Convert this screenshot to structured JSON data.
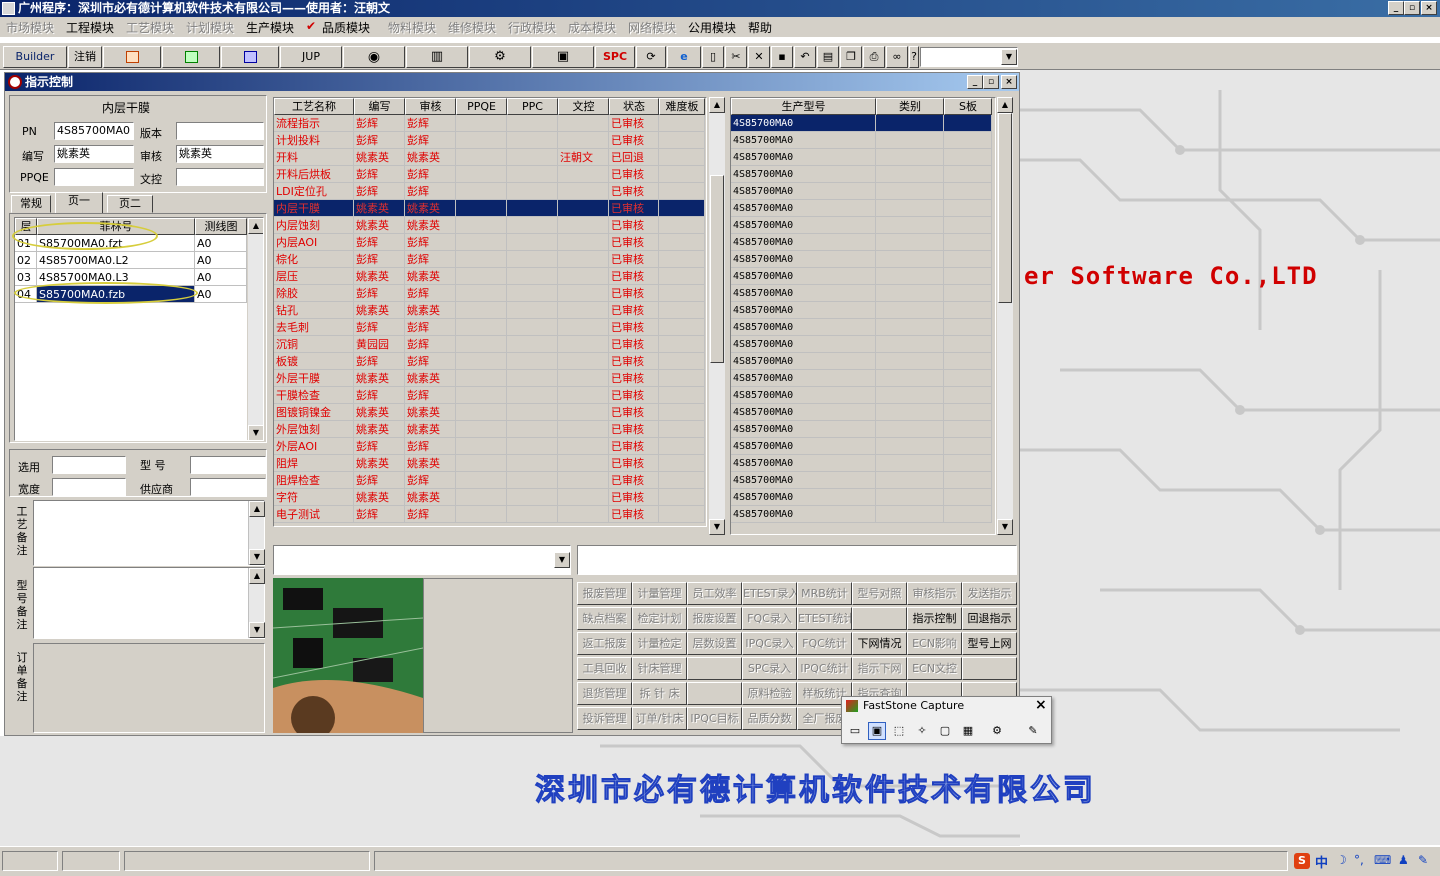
{
  "app": {
    "title": "广州程序：深圳市必有德计算机软件技术有限公司——使用者：汪朝文",
    "win_buttons": [
      "_",
      "▫",
      "×"
    ]
  },
  "menu": [
    {
      "label": "市场模块",
      "enabled": false
    },
    {
      "label": "工程模块",
      "enabled": true
    },
    {
      "label": "工艺模块",
      "enabled": false
    },
    {
      "label": "计划模块",
      "enabled": false
    },
    {
      "label": "生产模块",
      "enabled": true
    },
    {
      "label": "品质模块",
      "enabled": true
    },
    {
      "label": "物料模块",
      "enabled": false
    },
    {
      "label": "维修模块",
      "enabled": false
    },
    {
      "label": "行政模块",
      "enabled": false
    },
    {
      "label": "成本模块",
      "enabled": false
    },
    {
      "label": "网络模块",
      "enabled": false
    },
    {
      "label": "公用模块",
      "enabled": true
    },
    {
      "label": "帮助",
      "enabled": true
    }
  ],
  "toolbar": {
    "builder": "Builder",
    "logout": "注销",
    "jup": "JUP",
    "spc": "SPC"
  },
  "watermark": "er Software Co.,LTD",
  "banner": "深圳市必有德计算机软件技术有限公司",
  "child": {
    "title": "指示控制",
    "section_title": "内层干膜",
    "pn_label": "PN",
    "pn_value": "4S85700MA0",
    "version_label": "版本",
    "version_value": "",
    "author_label": "编写",
    "author_value": "姚素英",
    "review_label": "审核",
    "review_value": "姚素英",
    "ppqe_label": "PPQE",
    "ppqe_value": "",
    "doc_label": "文控",
    "doc_value": "",
    "tabs": [
      "常规",
      "页一",
      "页二"
    ],
    "film_headers": [
      "层",
      "菲林号",
      "测线图"
    ],
    "film_rows": [
      {
        "layer": "01",
        "film": "S85700MA0.fzt",
        "chart": "A0"
      },
      {
        "layer": "02",
        "film": "4S85700MA0.L2",
        "chart": "A0"
      },
      {
        "layer": "03",
        "film": "4S85700MA0.L3",
        "chart": "A0"
      },
      {
        "layer": "04",
        "film": "S85700MA0.fzb",
        "chart": "A0"
      }
    ],
    "choose_label": "选用",
    "model_label": "型  号",
    "width_label": "宽度",
    "supplier_label": "供应商",
    "note_process": "工艺备注",
    "note_model": "型号备注",
    "note_order": "订单备注"
  },
  "process_table": {
    "headers": [
      "工艺名称",
      "编写",
      "审核",
      "PPQE",
      "PPC",
      "文控",
      "状态",
      "难度板"
    ],
    "rows": [
      [
        "流程指示",
        "彭辉",
        "彭辉",
        "",
        "",
        "",
        "已审核"
      ],
      [
        "计划投料",
        "彭辉",
        "彭辉",
        "",
        "",
        "",
        "已审核"
      ],
      [
        "开料",
        "姚素英",
        "姚素英",
        "",
        "",
        "汪朝文",
        "已回退"
      ],
      [
        "开料后烘板",
        "彭辉",
        "彭辉",
        "",
        "",
        "",
        "已审核"
      ],
      [
        "LDI定位孔",
        "彭辉",
        "彭辉",
        "",
        "",
        "",
        "已审核"
      ],
      [
        "内层干膜",
        "姚素英",
        "姚素英",
        "",
        "",
        "",
        "已审核"
      ],
      [
        "内层蚀刻",
        "姚素英",
        "姚素英",
        "",
        "",
        "",
        "已审核"
      ],
      [
        "内层AOI",
        "彭辉",
        "彭辉",
        "",
        "",
        "",
        "已审核"
      ],
      [
        "棕化",
        "彭辉",
        "彭辉",
        "",
        "",
        "",
        "已审核"
      ],
      [
        "层压",
        "姚素英",
        "姚素英",
        "",
        "",
        "",
        "已审核"
      ],
      [
        "除胶",
        "彭辉",
        "彭辉",
        "",
        "",
        "",
        "已审核"
      ],
      [
        "钻孔",
        "姚素英",
        "姚素英",
        "",
        "",
        "",
        "已审核"
      ],
      [
        "去毛刺",
        "彭辉",
        "彭辉",
        "",
        "",
        "",
        "已审核"
      ],
      [
        "沉铜",
        "黄园园",
        "彭辉",
        "",
        "",
        "",
        "已审核"
      ],
      [
        "板镀",
        "彭辉",
        "彭辉",
        "",
        "",
        "",
        "已审核"
      ],
      [
        "外层干膜",
        "姚素英",
        "姚素英",
        "",
        "",
        "",
        "已审核"
      ],
      [
        "干膜检查",
        "彭辉",
        "彭辉",
        "",
        "",
        "",
        "已审核"
      ],
      [
        "图镀铜镍金",
        "姚素英",
        "姚素英",
        "",
        "",
        "",
        "已审核"
      ],
      [
        "外层蚀刻",
        "姚素英",
        "姚素英",
        "",
        "",
        "",
        "已审核"
      ],
      [
        "外层AOI",
        "彭辉",
        "彭辉",
        "",
        "",
        "",
        "已审核"
      ],
      [
        "阻焊",
        "姚素英",
        "姚素英",
        "",
        "",
        "",
        "已审核"
      ],
      [
        "阻焊检查",
        "彭辉",
        "彭辉",
        "",
        "",
        "",
        "已审核"
      ],
      [
        "字符",
        "姚素英",
        "姚素英",
        "",
        "",
        "",
        "已审核"
      ],
      [
        "电子测试",
        "彭辉",
        "彭辉",
        "",
        "",
        "",
        "已审核"
      ]
    ],
    "selected_index": 5
  },
  "model_table": {
    "headers": [
      "生产型号",
      "类别",
      "S板"
    ],
    "value": "4S85700MA0",
    "row_count": 24
  },
  "buttons": [
    [
      "报废管理",
      "计量管理",
      "员工效率",
      "ETEST录入",
      "MRB统计",
      "型号对照",
      "审核指示",
      "发送指示"
    ],
    [
      "缺点档案",
      "检定计划",
      "报废设置",
      "FQC录入",
      "ETEST统计",
      "",
      "指示控制",
      "回退指示"
    ],
    [
      "返工报废",
      "计量检定",
      "层数设置",
      "IPQC录入",
      "FQC统计",
      "下网情况",
      "ECN影响",
      "型号上网"
    ],
    [
      "工具回收",
      "针床管理",
      "",
      "SPC录入",
      "IPQC统计",
      "指示下网",
      "ECN文控",
      ""
    ],
    [
      "退货管理",
      "拆 针 床",
      "",
      "原料检验",
      "样板统计",
      "指示查询",
      "",
      ""
    ],
    [
      "投诉管理",
      "订单/针床",
      "IPQC目标",
      "品质分数",
      "全厂报废",
      "",
      "",
      ""
    ]
  ],
  "enabled_buttons": [
    "指示控制",
    "回退指示",
    "下网情况",
    "型号上网"
  ],
  "faststone": {
    "title": "FastStone Capture",
    "close": "×"
  },
  "ime": "中"
}
